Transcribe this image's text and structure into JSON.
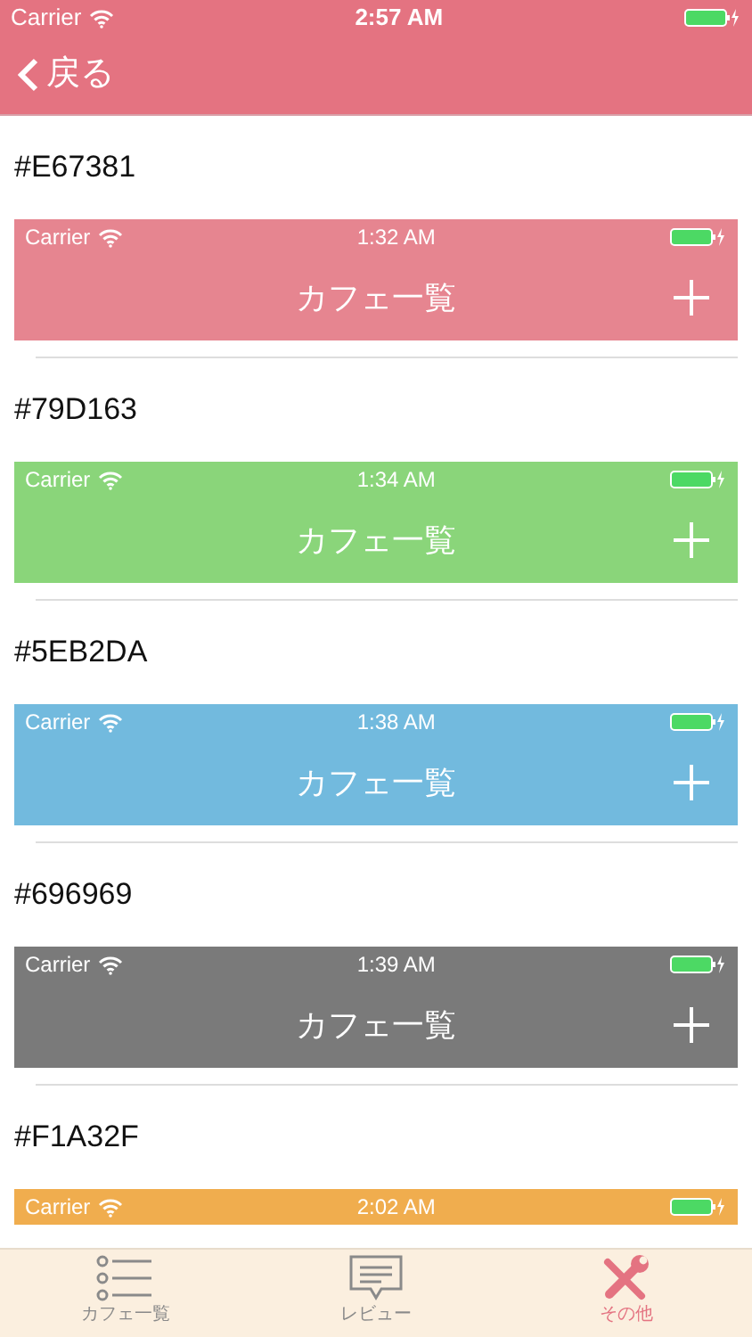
{
  "status_bar": {
    "carrier": "Carrier",
    "time": "2:57 AM"
  },
  "nav": {
    "back_label": "戻る"
  },
  "themes": [
    {
      "label": "#E67381",
      "color": "#e68590",
      "preview": {
        "carrier": "Carrier",
        "time": "1:32 AM",
        "title": "カフェ一覧"
      }
    },
    {
      "label": "#79D163",
      "color": "#8ad57a",
      "preview": {
        "carrier": "Carrier",
        "time": "1:34 AM",
        "title": "カフェ一覧"
      }
    },
    {
      "label": "#5EB2DA",
      "color": "#72bade",
      "preview": {
        "carrier": "Carrier",
        "time": "1:38 AM",
        "title": "カフェ一覧"
      }
    },
    {
      "label": "#696969",
      "color": "#7a7a7a",
      "preview": {
        "carrier": "Carrier",
        "time": "1:39 AM",
        "title": "カフェ一覧"
      }
    },
    {
      "label": "#F1A32F",
      "color": "#f0ad4e",
      "preview": {
        "carrier": "Carrier",
        "time": "2:02 AM"
      }
    }
  ],
  "tabs": [
    {
      "kind": "list",
      "label": "カフェ一覧",
      "selected": false
    },
    {
      "kind": "review",
      "label": "レビュー",
      "selected": false
    },
    {
      "kind": "tools",
      "label": "その他",
      "selected": true
    }
  ]
}
